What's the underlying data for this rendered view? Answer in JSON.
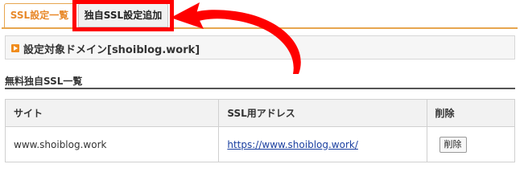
{
  "tabs": {
    "ssl_list_label": "SSL設定一覧",
    "ssl_add_label": "独自SSL設定追加"
  },
  "domain_panel": {
    "title": "設定対象ドメイン[shoiblog.work]"
  },
  "section": {
    "title": "無料独自SSL一覧"
  },
  "table": {
    "headers": {
      "site": "サイト",
      "address": "SSL用アドレス",
      "delete": "削除"
    },
    "rows": [
      {
        "site": "www.shoiblog.work",
        "address": "https://www.shoiblog.work/",
        "delete_label": "削除"
      }
    ]
  },
  "annotation": {
    "highlight_color": "#ff0000",
    "arrow_color": "#ff0000"
  },
  "colors": {
    "accent_orange": "#e8892a",
    "link_blue": "#1a3fa0"
  }
}
